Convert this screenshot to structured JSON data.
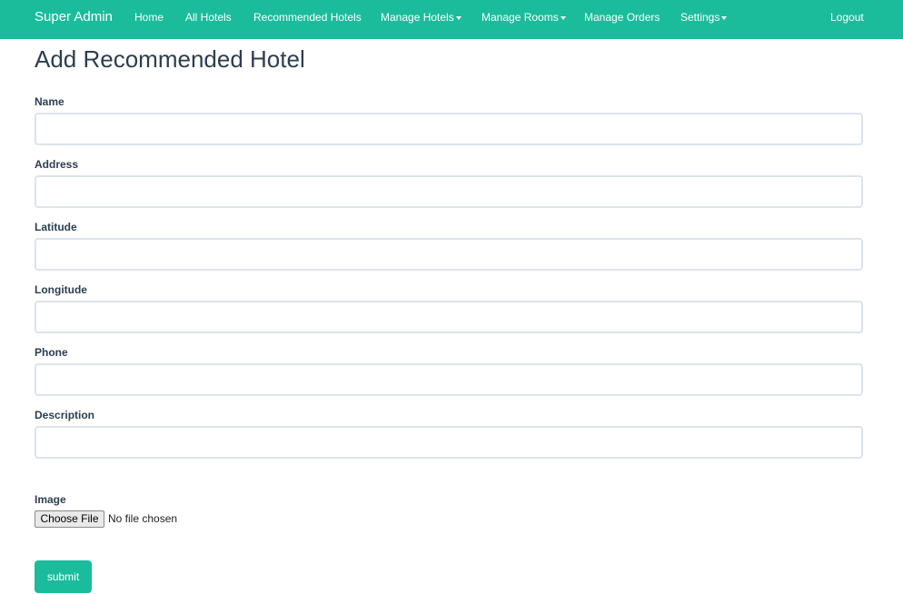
{
  "navbar": {
    "brand": "Super Admin",
    "items": [
      {
        "label": "Home",
        "dropdown": false
      },
      {
        "label": "All Hotels",
        "dropdown": false
      },
      {
        "label": "Recommended Hotels",
        "dropdown": false
      },
      {
        "label": "Manage Hotels",
        "dropdown": true
      },
      {
        "label": "Manage Rooms",
        "dropdown": true
      },
      {
        "label": "Manage Orders",
        "dropdown": false
      },
      {
        "label": "Settings",
        "dropdown": true
      }
    ],
    "logout": "Logout"
  },
  "page": {
    "title": "Add Recommended Hotel"
  },
  "form": {
    "fields": [
      {
        "label": "Name",
        "value": "",
        "placeholder": ""
      },
      {
        "label": "Address",
        "value": "",
        "placeholder": ""
      },
      {
        "label": "Latitude",
        "value": "",
        "placeholder": ""
      },
      {
        "label": "Longitude",
        "value": "",
        "placeholder": ""
      },
      {
        "label": "Phone",
        "value": "",
        "placeholder": ""
      },
      {
        "label": "Description",
        "value": "",
        "placeholder": ""
      }
    ],
    "image": {
      "label": "Image",
      "button": "Choose File",
      "status": "No file chosen"
    },
    "submit": "submit"
  },
  "colors": {
    "accent": "#1abc9c",
    "text": "#2c3e50",
    "input_border": "#dce4ec"
  }
}
